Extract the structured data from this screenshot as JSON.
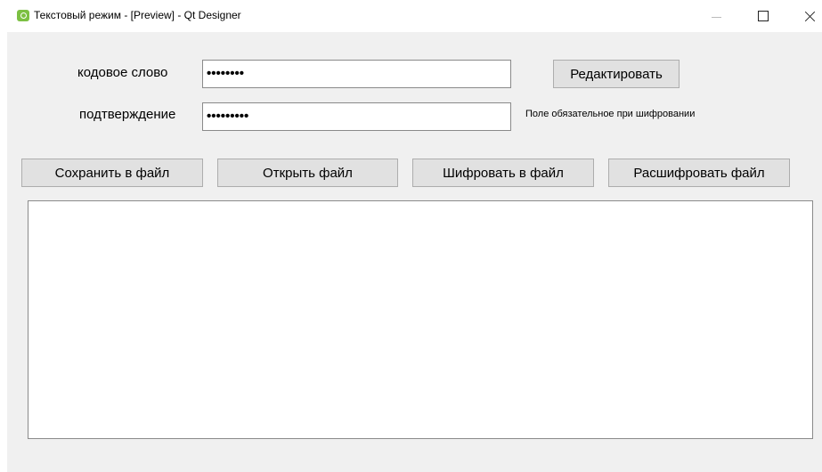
{
  "window": {
    "title": "Текстовый режим - [Preview] - Qt Designer",
    "app_icon": "qt-designer-icon"
  },
  "form": {
    "codeword_label": "кодовое слово",
    "codeword_value": "••••••••",
    "confirm_label": "подтверждение",
    "confirm_value": "•••••••••",
    "edit_button": "Редактировать",
    "hint": "Поле обязательное при шифровании"
  },
  "actions": {
    "save": "Сохранить в файл",
    "open": "Открыть файл",
    "encrypt": "Шифровать в файл",
    "decrypt": "Расшифровать файл"
  },
  "editor": {
    "content": ""
  }
}
